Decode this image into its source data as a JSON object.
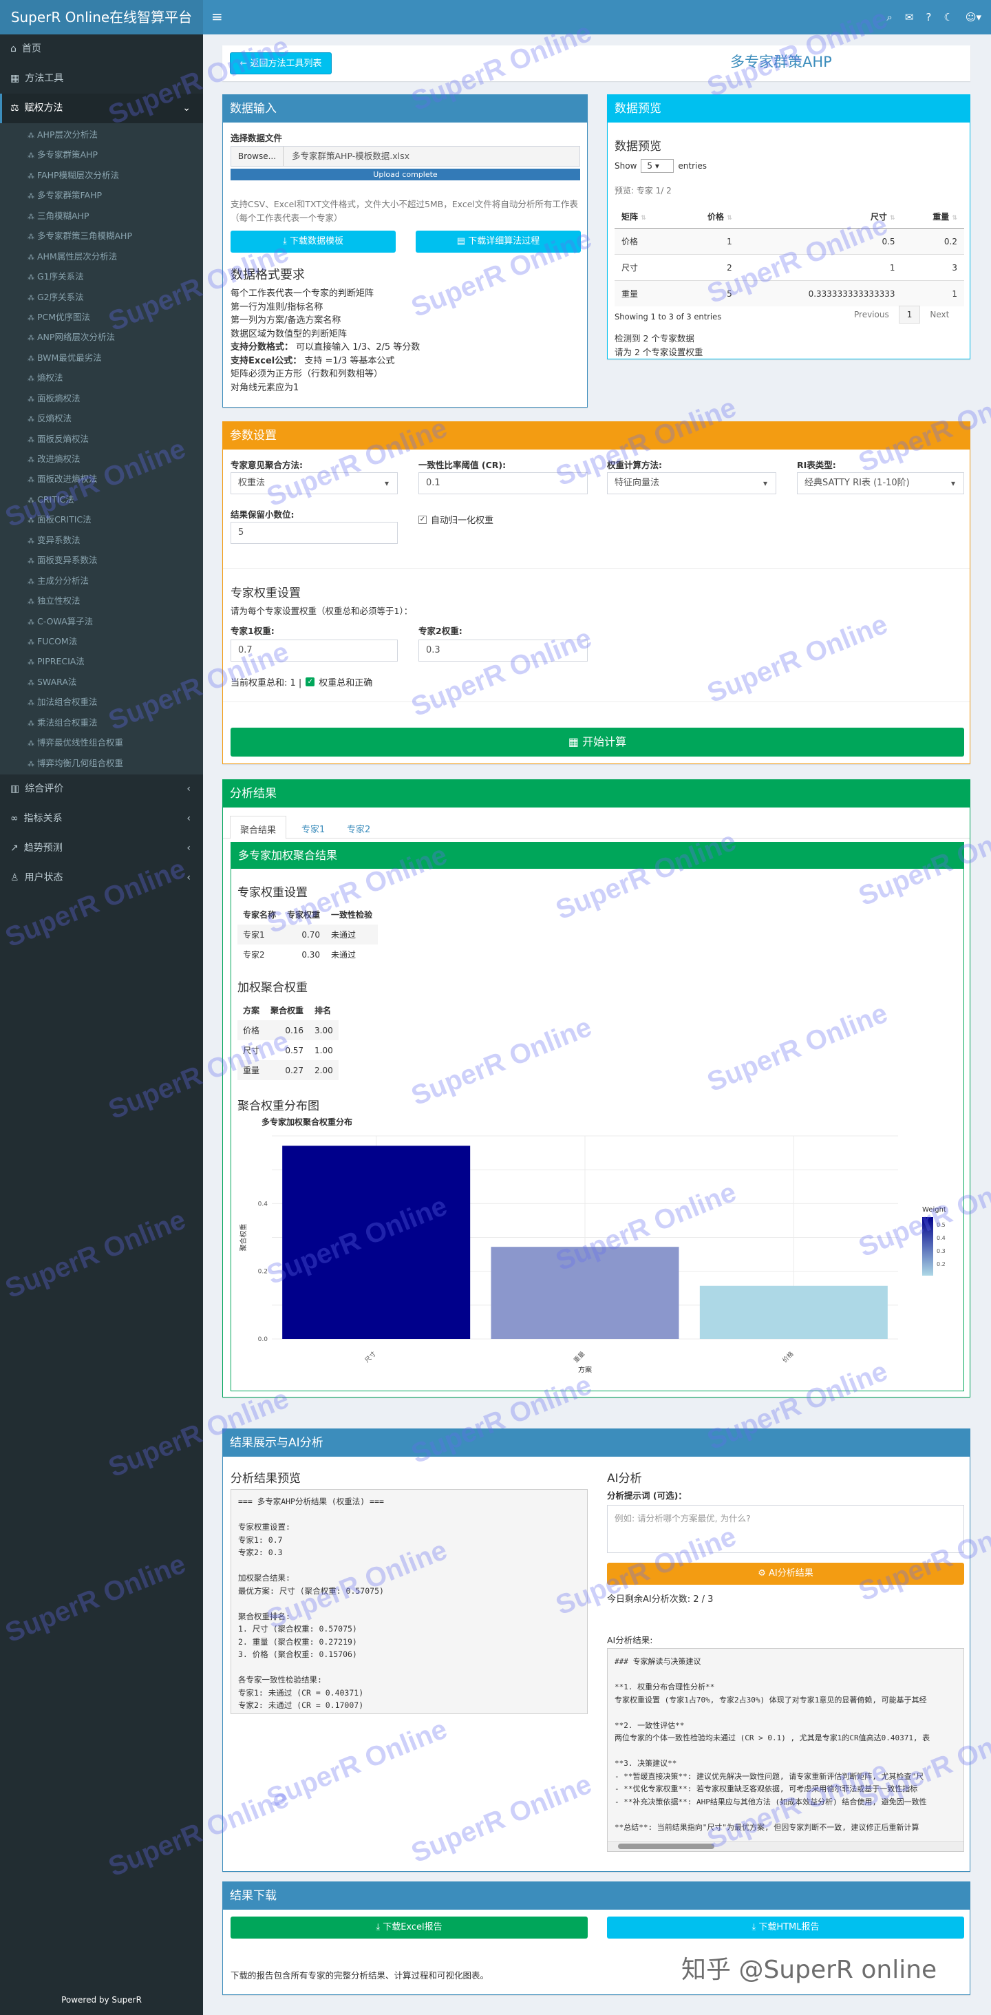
{
  "app": {
    "title": "SuperR Online在线智算平台",
    "powered": "Powered by SuperR"
  },
  "topbar": {
    "icons": [
      "menu-icon",
      "search-icon",
      "bell-icon",
      "help-icon",
      "moon-icon",
      "users-icon"
    ]
  },
  "sidebar": {
    "home": "首页",
    "tools": "方法工具",
    "weighting": "赋权方法",
    "sub_items": [
      "AHP层次分析法",
      "多专家群策AHP",
      "FAHP模糊层次分析法",
      "多专家群策FAHP",
      "三角模糊AHP",
      "多专家群策三角模糊AHP",
      "AHM属性层次分析法",
      "G1序关系法",
      "G2序关系法",
      "PCM优序图法",
      "ANP网络层次分析法",
      "BWM最优最劣法",
      "熵权法",
      "面板熵权法",
      "反熵权法",
      "面板反熵权法",
      "改进熵权法",
      "面板改进熵权法",
      "CRITIC法",
      "面板CRITIC法",
      "变异系数法",
      "面板变异系数法",
      "主成分分析法",
      "独立性权法",
      "C-OWA算子法",
      "FUCOM法",
      "PIPRECIA法",
      "SWARA法",
      "加法组合权重法",
      "乘法组合权重法",
      "博弈最优线性组合权重",
      "博弈均衡几何组合权重"
    ],
    "comprehensive": "综合评价",
    "indicators": "指标关系",
    "trend": "趋势预测",
    "user": "用户状态"
  },
  "header": {
    "back_button": "返回方法工具列表",
    "title": "多专家群策AHP"
  },
  "input": {
    "title": "数据输入",
    "file_label": "选择数据文件",
    "browse": "Browse...",
    "file_name": "多专家群策AHP-模板数据.xlsx",
    "upload_status": "Upload complete",
    "hint": "支持CSV、Excel和TXT文件格式，文件大小不超过5MB，Excel文件将自动分析所有工作表（每个工作表代表一个专家）",
    "download_template": "下载数据模板",
    "download_algo": "下载详细算法过程",
    "format_title": "数据格式要求",
    "format_lines": [
      "每个工作表代表一个专家的判断矩阵",
      "第一行为准则/指标名称",
      "第一列为方案/备选方案名称",
      "数据区域为数值型的判断矩阵"
    ],
    "fraction_label": "支持分数格式：",
    "fraction_text": "可以直接输入 1/3、2/5 等分数",
    "excel_label": "支持Excel公式：",
    "excel_text": "支持 =1/3 等基本公式",
    "format_tail": [
      "矩阵必须为正方形（行数和列数相等）",
      "对角线元素应为1"
    ]
  },
  "preview": {
    "title": "数据预览",
    "subtitle": "数据预览",
    "show": "Show",
    "entries_value": "5",
    "entries": "entries",
    "expert_info": "预览: 专家 1/ 2",
    "columns": [
      "矩阵",
      "价格",
      "尺寸",
      "重量"
    ],
    "rows": [
      [
        "价格",
        "1",
        "0.5",
        "0.2"
      ],
      [
        "尺寸",
        "2",
        "1",
        "3"
      ],
      [
        "重量",
        "5",
        "0.333333333333333",
        "1"
      ]
    ],
    "showing": "Showing 1 to 3 of 3 entries",
    "prev": "Previous",
    "page": "1",
    "next": "Next",
    "detected": "检测到 2 个专家数据",
    "please_set": "请为 2 个专家设置权重"
  },
  "params": {
    "title": "参数设置",
    "agg_label": "专家意见聚合方法:",
    "agg_value": "权重法",
    "cr_label": "一致性比率阈值 (CR):",
    "cr_value": "0.1",
    "calc_label": "权重计算方法:",
    "calc_value": "特征向量法",
    "ri_label": "RI表类型:",
    "ri_value": "经典SATTY RI表 (1-10阶)",
    "decimals_label": "结果保留小数位:",
    "decimals_value": "5",
    "normalize_label": "自动归一化权重",
    "expert_weight_title": "专家权重设置",
    "expert_weight_hint": "请为每个专家设置权重（权重总和必须等于1）：",
    "e1_label": "专家1权重:",
    "e1_value": "0.7",
    "e2_label": "专家2权重:",
    "e2_value": "0.3",
    "sum_text": "当前权重总和: 1 |",
    "sum_ok": "权重总和正确",
    "start": "开始计算"
  },
  "results": {
    "title": "分析结果",
    "tabs": [
      "聚合结果",
      "专家1",
      "专家2"
    ],
    "sub_title": "多专家加权聚合结果",
    "weights_title": "专家权重设置",
    "weights_cols": [
      "专家名称",
      "专家权重",
      "一致性检验"
    ],
    "weights_rows": [
      [
        "专家1",
        "0.70",
        "未通过"
      ],
      [
        "专家2",
        "0.30",
        "未通过"
      ]
    ],
    "agg_title": "加权聚合权重",
    "agg_cols": [
      "方案",
      "聚合权重",
      "排名"
    ],
    "agg_rows": [
      [
        "价格",
        "0.16",
        "3.00"
      ],
      [
        "尺寸",
        "0.57",
        "1.00"
      ],
      [
        "重量",
        "0.27",
        "2.00"
      ]
    ],
    "chart_title": "聚合权重分布图"
  },
  "chart_data": {
    "type": "bar",
    "title": "多专家加权聚合权重分布",
    "categories": [
      "尺寸",
      "重量",
      "价格"
    ],
    "values": [
      0.57075,
      0.27219,
      0.15706
    ],
    "xlabel": "方案",
    "ylabel": "聚合权重",
    "ylim": [
      0,
      0.6
    ],
    "yticks": [
      "0.0",
      "0.2",
      "0.4"
    ],
    "legend_title": "Weight",
    "legend_ticks": [
      "0.5",
      "0.4",
      "0.3",
      "0.2"
    ],
    "legend_position": "right",
    "colors": [
      "#00008b",
      "#8b97cc",
      "#add8e6"
    ],
    "grid": true
  },
  "ai": {
    "title": "结果展示与AI分析",
    "preview_title": "分析结果预览",
    "preview_text": "=== 多专家AHP分析结果 (权重法) ===\n\n专家权重设置:\n专家1: 0.7\n专家2: 0.3\n\n加权聚合结果:\n最优方案: 尺寸 (聚合权重: 0.57075)\n\n聚合权重排名:\n1. 尺寸 (聚合权重: 0.57075)\n2. 重量 (聚合权重: 0.27219)\n3. 价格 (聚合权重: 0.15706)\n\n各专家一致性检验结果:\n专家1: 未通过 (CR = 0.40371)\n专家2: 未通过 (CR = 0.17007)",
    "ai_title": "AI分析",
    "prompt_label": "分析提示词 (可选)：",
    "prompt_placeholder": "例如: 请分析哪个方案最优, 为什么?",
    "ai_button": "AI分析结果",
    "remaining": "今日剩余AI分析次数: 2 / 3",
    "result_label": "AI分析结果:",
    "result_text": "### 专家解读与决策建议\n\n**1. 权重分布合理性分析**\n专家权重设置 (专家1占70%, 专家2占30%) 体现了对专家1意见的显著倚赖, 可能基于其经\n\n**2. 一致性评估**\n两位专家的个体一致性检验均未通过 (CR > 0.1) , 尤其是专家1的CR值高达0.40371, 表\n\n**3. 决策建议**\n- **暂缓直接决策**: 建议优先解决一致性问题, 请专家重新评估判断矩阵, 尤其检查\"尺\n- **优化专家权重**: 若专家权重缺乏客观依据, 可考虑采用德尔菲法或基于一致性指标\n- **补充决策依据**: AHP结果应与其他方法 (如成本效益分析) 结合使用, 避免因一致性\n\n**总结**: 当前结果指向\"尺寸\"为最优方案, 但因专家判断不一致, 建议修正后重新计算"
  },
  "download": {
    "title": "结果下载",
    "excel": "下载Excel报告",
    "html": "下载HTML报告",
    "note": "下载的报告包含所有专家的完整分析结果、计算过程和可视化图表。"
  },
  "watermark": "SuperR Online",
  "zhihu": "知乎 @SuperR online"
}
